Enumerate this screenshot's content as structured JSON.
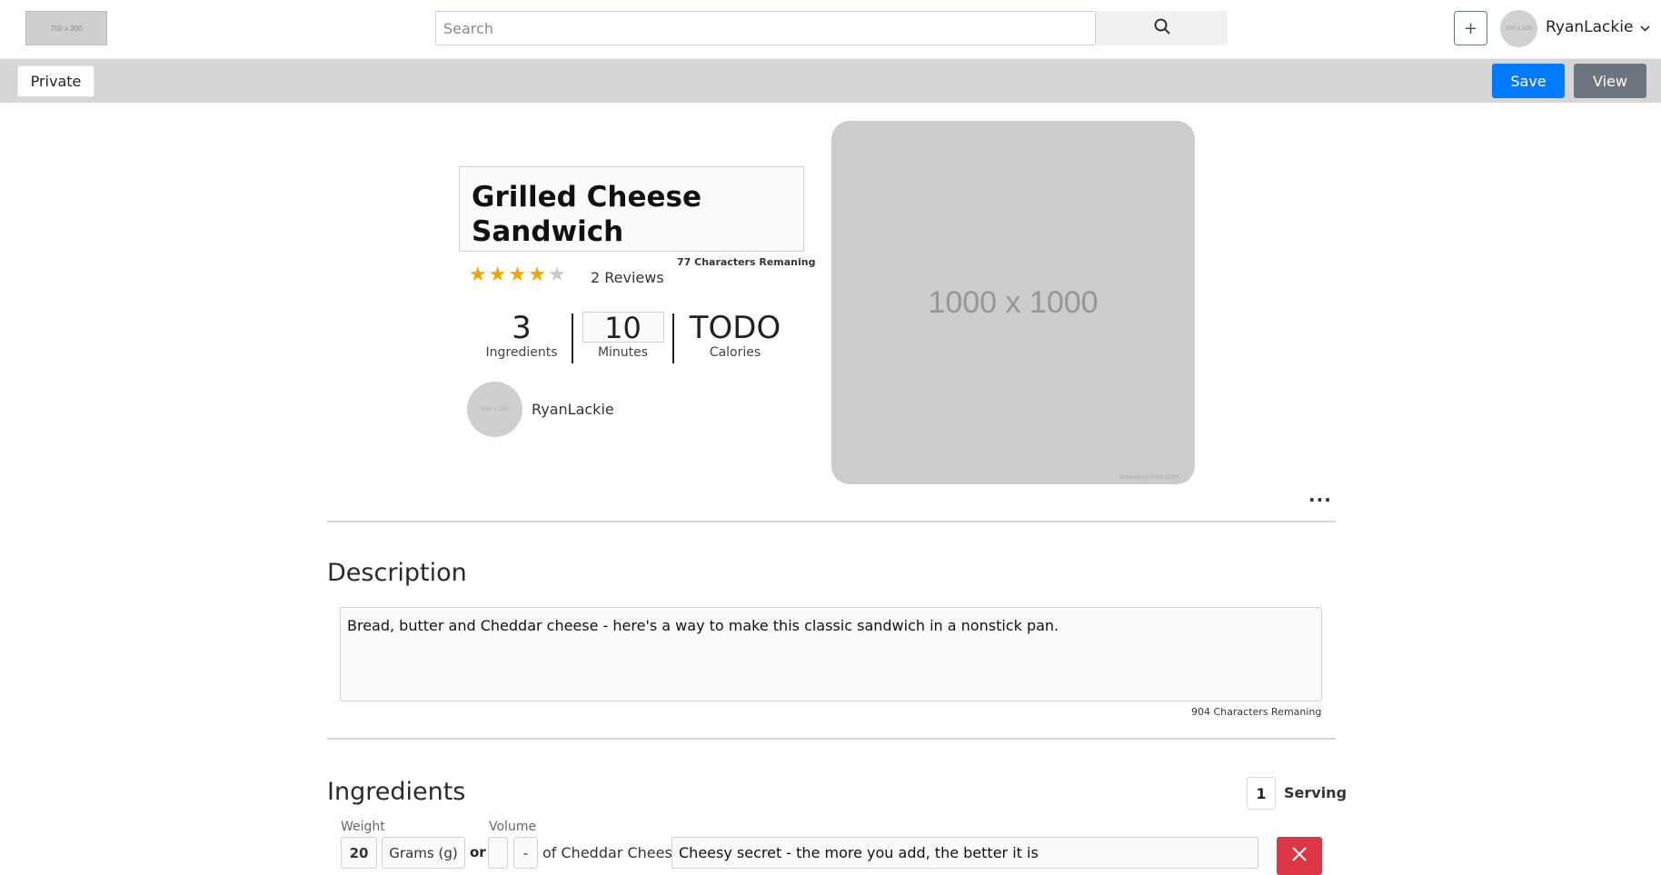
{
  "nav": {
    "logo_text": "700 x 300",
    "search_placeholder": "Search",
    "plus_label": "+",
    "avatar_text": "100 x 100",
    "username": "RyanLackie"
  },
  "toolbar": {
    "private_label": "Private",
    "save_label": "Save",
    "view_label": "View"
  },
  "recipe": {
    "title": "Grilled Cheese Sandwich",
    "title_remaining": "77 Characters Remaning",
    "rating_stars_filled": 4,
    "rating_stars_total": 5,
    "reviews": "2 Reviews",
    "ingredients_count": "3",
    "ingredients_label": "Ingredients",
    "minutes": "10",
    "minutes_label": "Minutes",
    "calories": "TODO",
    "calories_label": "Calories",
    "author_avatar_text": "100 x 100",
    "author": "RyanLackie",
    "image_text": "1000 x 1000",
    "image_credit": "Powered by HTML.COM",
    "more_label": "···"
  },
  "description": {
    "heading": "Description",
    "text": "Bread, butter and Cheddar cheese - here's a way to make this classic sandwich in a nonstick pan.",
    "remaining": "904 Characters Remaning"
  },
  "ingredients": {
    "heading": "Ingredients",
    "servings": "1",
    "serving_label": "Serving",
    "weight_label": "Weight",
    "volume_label": "Volume",
    "rows": [
      {
        "weight_value": "20",
        "weight_unit": "Grams (g)",
        "or_label": "or",
        "volume_value": "",
        "volume_unit": "-",
        "name": "of Cheddar Cheese",
        "note": "Cheesy secret - the more you add, the better it is"
      }
    ]
  },
  "colors": {
    "primary": "#007bff",
    "secondary": "#6c757d",
    "danger": "#dc3545",
    "star": "#f0a500",
    "toolbar_bg": "#d6d6d6"
  }
}
